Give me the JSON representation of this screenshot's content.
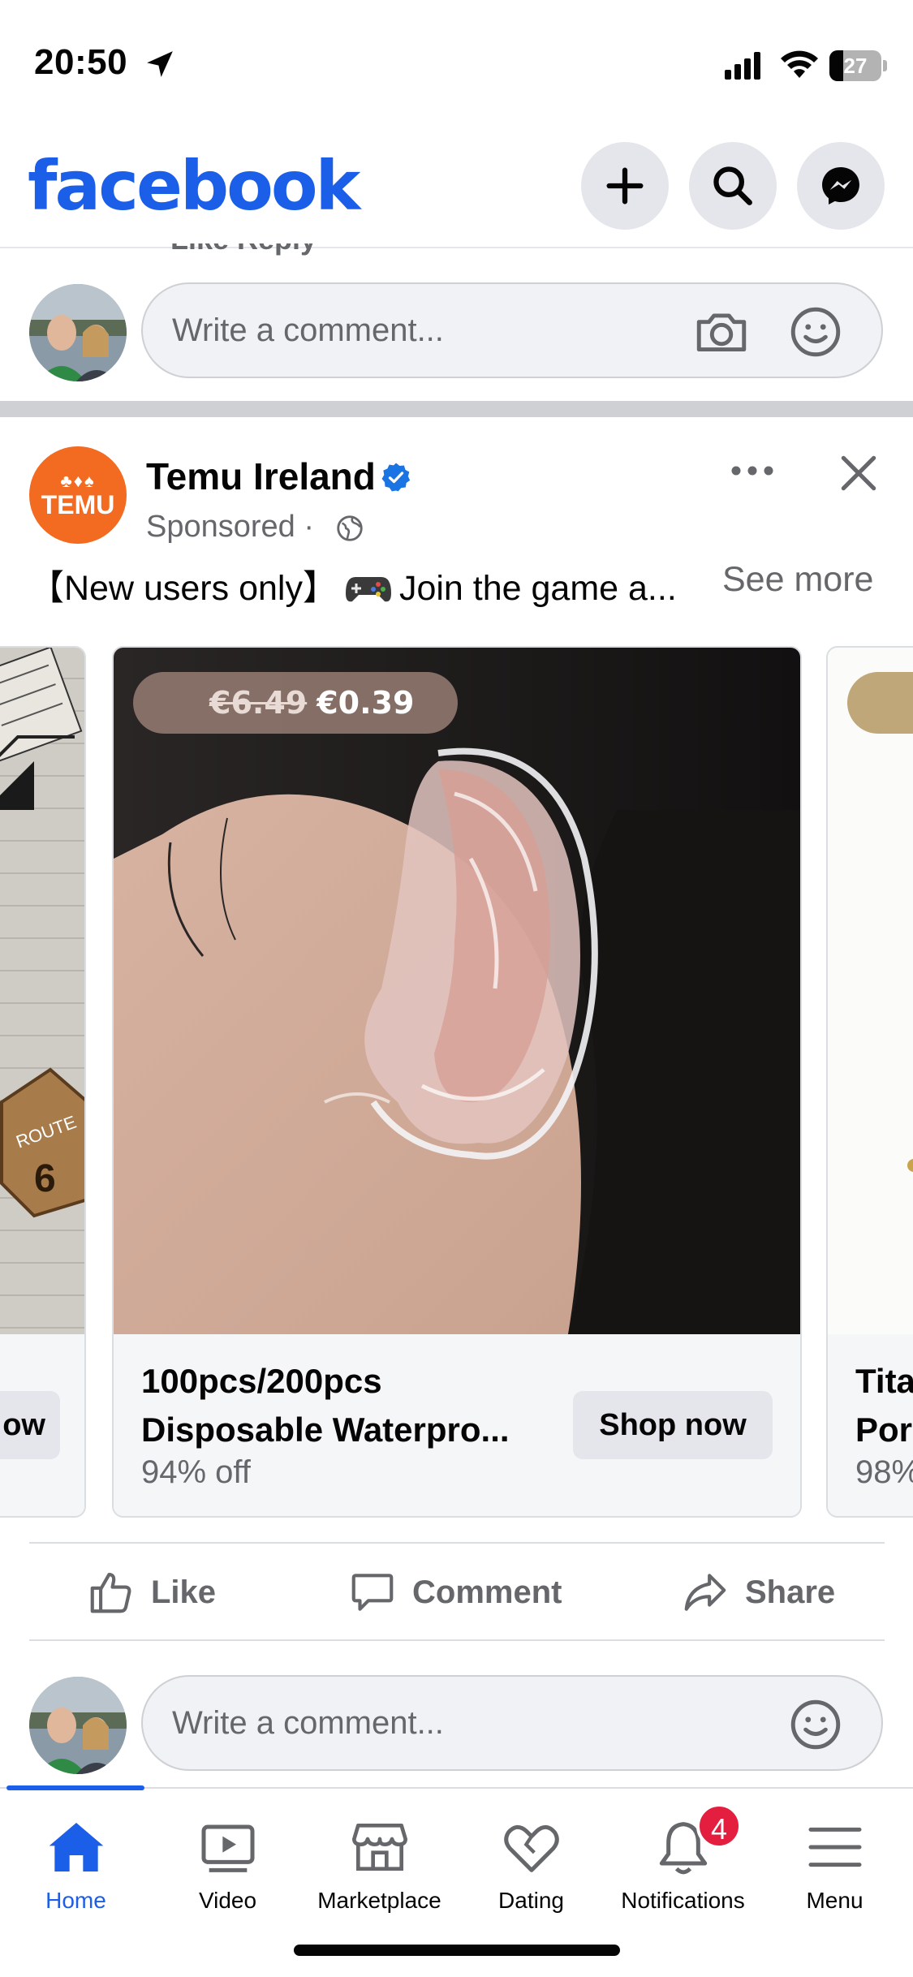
{
  "status_bar": {
    "time": "20:50",
    "battery": "27",
    "battery_level": 0.27
  },
  "header": {
    "logo": "facebook"
  },
  "previous_post": {
    "actions_peek": "Like    Reply",
    "comment_placeholder": "Write a comment..."
  },
  "post": {
    "page_name": "Temu Ireland",
    "sponsored": "Sponsored · ",
    "text": "【New users only】",
    "text_after": "Join the game a...",
    "see_more": "See more",
    "cards": {
      "left": {
        "button_partial": "ow"
      },
      "main": {
        "old_price": "€6.49",
        "new_price": "€0.39",
        "title_line1": "100pcs/200pcs",
        "title_line2": "Disposable Waterpro...",
        "discount": "94% off",
        "button": "Shop now"
      },
      "right": {
        "title_line1": "Tita",
        "title_line2": "Por",
        "discount": "98%"
      }
    },
    "actions": {
      "like": "Like",
      "comment": "Comment",
      "share": "Share"
    },
    "comment_placeholder": "Write a comment..."
  },
  "tabbar": {
    "home": "Home",
    "video": "Video",
    "marketplace": "Marketplace",
    "dating": "Dating",
    "notifications": "Notifications",
    "notifications_badge": "4",
    "menu": "Menu"
  },
  "colors": {
    "brand": "#1b5ee8",
    "temu": "#f26b21",
    "badge": "#e41e3f"
  }
}
